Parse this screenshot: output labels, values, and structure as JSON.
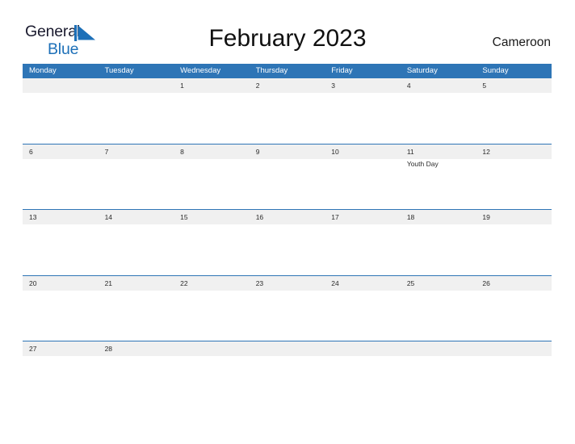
{
  "logo": {
    "word1": "General",
    "word2": "Blue",
    "mark": "triangle-pennant",
    "color_dark": "#1a1a2e",
    "color_blue": "#1d70b8"
  },
  "header": {
    "title": "February 2023",
    "country": "Cameroon"
  },
  "theme": {
    "header_blue": "#2e75b6",
    "band_gray": "#f0f0f0",
    "page_background": "#ffffff",
    "text": "#2a2a2a"
  },
  "calendar": {
    "month": "February",
    "year": "2023",
    "weekday_headers": [
      "Monday",
      "Tuesday",
      "Wednesday",
      "Thursday",
      "Friday",
      "Saturday",
      "Sunday"
    ],
    "weeks": [
      [
        {
          "num": "",
          "event": ""
        },
        {
          "num": "",
          "event": ""
        },
        {
          "num": "1",
          "event": ""
        },
        {
          "num": "2",
          "event": ""
        },
        {
          "num": "3",
          "event": ""
        },
        {
          "num": "4",
          "event": ""
        },
        {
          "num": "5",
          "event": ""
        }
      ],
      [
        {
          "num": "6",
          "event": ""
        },
        {
          "num": "7",
          "event": ""
        },
        {
          "num": "8",
          "event": ""
        },
        {
          "num": "9",
          "event": ""
        },
        {
          "num": "10",
          "event": ""
        },
        {
          "num": "11",
          "event": "Youth Day"
        },
        {
          "num": "12",
          "event": ""
        }
      ],
      [
        {
          "num": "13",
          "event": ""
        },
        {
          "num": "14",
          "event": ""
        },
        {
          "num": "15",
          "event": ""
        },
        {
          "num": "16",
          "event": ""
        },
        {
          "num": "17",
          "event": ""
        },
        {
          "num": "18",
          "event": ""
        },
        {
          "num": "19",
          "event": ""
        }
      ],
      [
        {
          "num": "20",
          "event": ""
        },
        {
          "num": "21",
          "event": ""
        },
        {
          "num": "22",
          "event": ""
        },
        {
          "num": "23",
          "event": ""
        },
        {
          "num": "24",
          "event": ""
        },
        {
          "num": "25",
          "event": ""
        },
        {
          "num": "26",
          "event": ""
        }
      ],
      [
        {
          "num": "27",
          "event": ""
        },
        {
          "num": "28",
          "event": ""
        },
        {
          "num": "",
          "event": ""
        },
        {
          "num": "",
          "event": ""
        },
        {
          "num": "",
          "event": ""
        },
        {
          "num": "",
          "event": ""
        },
        {
          "num": "",
          "event": ""
        }
      ]
    ]
  }
}
